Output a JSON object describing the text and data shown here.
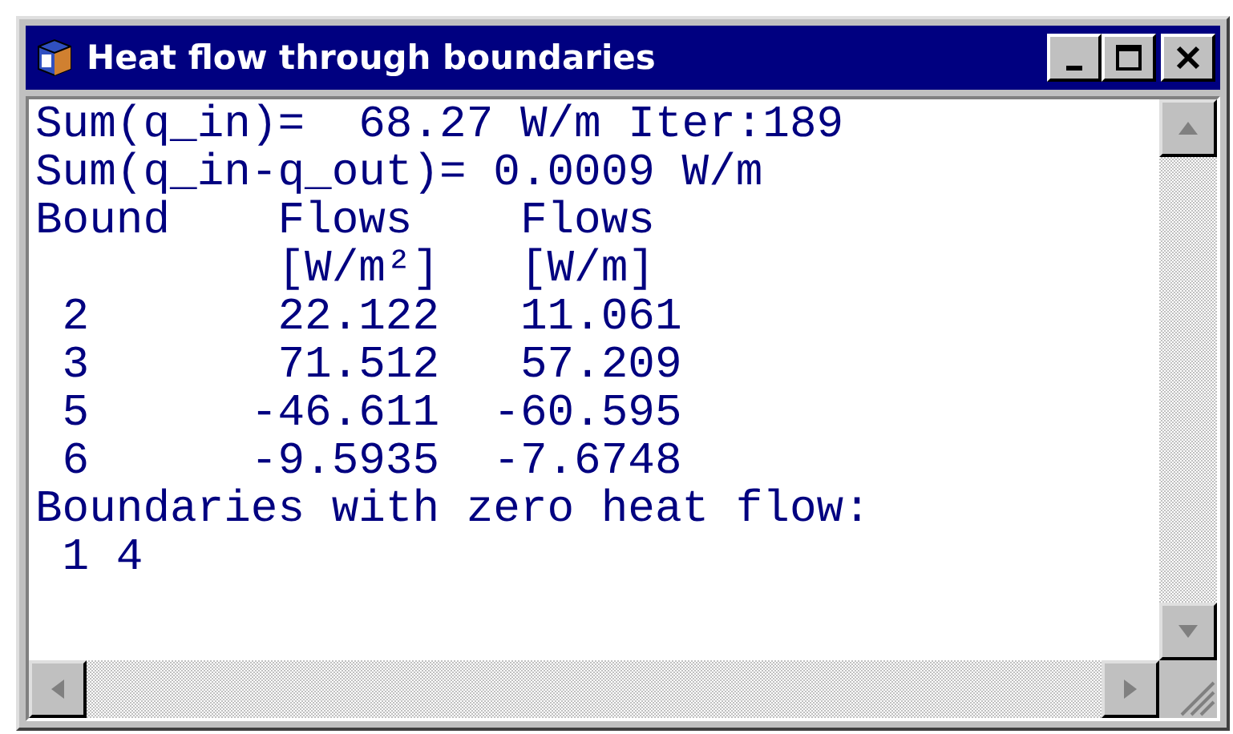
{
  "window": {
    "title": "Heat flow through boundaries"
  },
  "summary": [
    "Sum(q_in)=  68.27 W/m Iter:189",
    "Sum(q_in-q_out)= 0.0009 W/m"
  ],
  "table": {
    "columns": [
      {
        "heading": "Bound"
      },
      {
        "heading": "Flows",
        "unit": "[W/m²]"
      },
      {
        "heading": "Flows",
        "unit": "[W/m]"
      }
    ],
    "rows": [
      [
        "2",
        "22.122",
        "11.061"
      ],
      [
        "3",
        "71.512",
        "57.209"
      ],
      [
        "5",
        "-46.611",
        "-60.595"
      ],
      [
        "6",
        "-9.5935",
        "-7.6748"
      ]
    ]
  },
  "footer": {
    "label": "Boundaries with zero heat flow:",
    "values": "1 4"
  }
}
